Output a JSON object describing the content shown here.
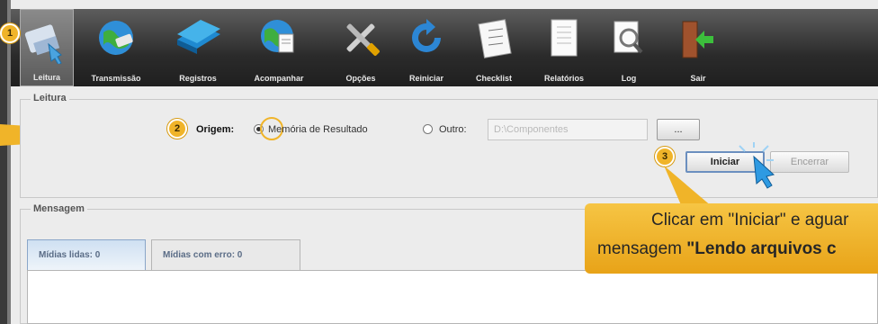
{
  "toolbar": {
    "items": [
      {
        "label": "Leitura",
        "icon": "reader-card-icon",
        "active": true
      },
      {
        "label": "Transmissão",
        "icon": "globe-transmit-icon"
      },
      {
        "label": "Registros",
        "icon": "books-icon"
      },
      {
        "label": "Acompanhar",
        "icon": "globe-document-icon"
      },
      {
        "label": "Opções",
        "icon": "tools-icon"
      },
      {
        "label": "Reiniciar",
        "icon": "refresh-icon"
      },
      {
        "label": "Checklist",
        "icon": "checklist-icon"
      },
      {
        "label": "Relatórios",
        "icon": "report-icon"
      },
      {
        "label": "Log",
        "icon": "magnifier-icon"
      },
      {
        "label": "Sair",
        "icon": "exit-door-icon"
      }
    ]
  },
  "leitura": {
    "group_title": "Leitura",
    "origem_label": "Origem:",
    "option_memoria": "Memória de Resultado",
    "option_outro": "Outro:",
    "path_value": "D:\\Componentes",
    "browse_label": "...",
    "iniciar_label": "Iniciar",
    "encerrar_label": "Encerrar"
  },
  "mensagem": {
    "group_title": "Mensagem",
    "tabs": [
      {
        "label": "Mídias lidas: 0"
      },
      {
        "label": "Mídias com erro: 0"
      }
    ]
  },
  "badges": {
    "one": "1",
    "two": "2",
    "three": "3"
  },
  "callout": {
    "line1": "Clicar em \"Iniciar\"  e aguar",
    "line2_prefix": "mensagem ",
    "line2_bold": "\"Lendo arquivos c"
  },
  "colors": {
    "accent": "#f0b429",
    "tab_active": "#cfe0f2"
  }
}
